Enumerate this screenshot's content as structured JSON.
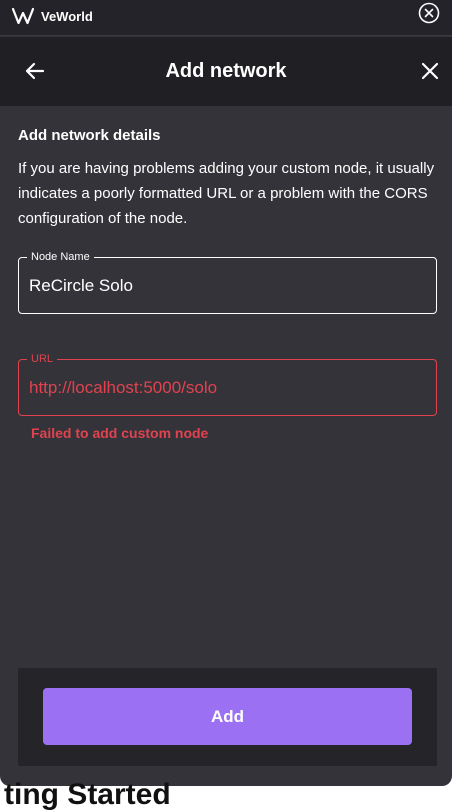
{
  "titlebar": {
    "app_name": "VeWorld",
    "logo_icon": "veworld-logo-icon",
    "close_icon": "circle-close-icon"
  },
  "header": {
    "title": "Add network",
    "back_icon": "arrow-left-icon",
    "close_icon": "close-icon"
  },
  "content": {
    "section_title": "Add network details",
    "description": "If you are having problems adding your custom node, it usually indicates a poorly formatted URL or a problem with the CORS configuration of the node."
  },
  "form": {
    "node_name": {
      "label": "Node Name",
      "value": "ReCircle Solo"
    },
    "url": {
      "label": "URL",
      "value": "http://localhost:5000/solo",
      "error": "Failed to add custom node"
    }
  },
  "footer": {
    "add_label": "Add"
  },
  "background": {
    "partial_text": "ting Started"
  },
  "colors": {
    "window_bg": "#35333a",
    "header_bg": "#202024",
    "accent": "#9b70f2",
    "error": "#e0434f"
  }
}
